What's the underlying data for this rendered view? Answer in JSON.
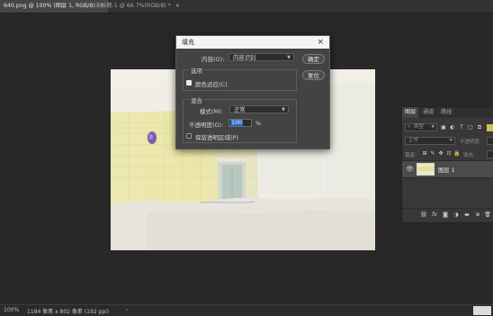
{
  "tabs": [
    {
      "label": "640.png @ 100% (图层 1, RGB/8)",
      "close": "×",
      "active": true
    },
    {
      "label": "未标题-1 @ 66.7%(RGB/8) *",
      "close": "×",
      "active": false
    }
  ],
  "dialog": {
    "title": "填充",
    "close": "×",
    "contents_label": "内容(O):",
    "contents_value": "内容识别",
    "options_legend": "选项",
    "color_adapt_label": "颜色适应(C)",
    "color_adapt_checked": true,
    "blending_legend": "混合",
    "mode_label": "模式(M):",
    "mode_value": "正常",
    "opacity_label": "不透明度(O):",
    "opacity_value": "100",
    "opacity_unit": "%",
    "preserve_label": "保留透明区域(P)",
    "preserve_checked": false,
    "ok_label": "确定",
    "cancel_label": "复位"
  },
  "layers_panel": {
    "tabs": [
      "图层",
      "通道",
      "路径"
    ],
    "kind_label": "类型",
    "blend_mode": "正常",
    "opacity_label": "不透明度:",
    "lock_label": "锁定:",
    "fill_label": "填充:",
    "layer_name": "图层 1"
  },
  "status": {
    "zoom": "100%",
    "doc_info": "1184 像素 x 802 像素 (192 ppi)"
  },
  "colors": {
    "accent_selection": "#2a64c5",
    "workspace": "#282828",
    "dialog_bg": "#434343"
  }
}
